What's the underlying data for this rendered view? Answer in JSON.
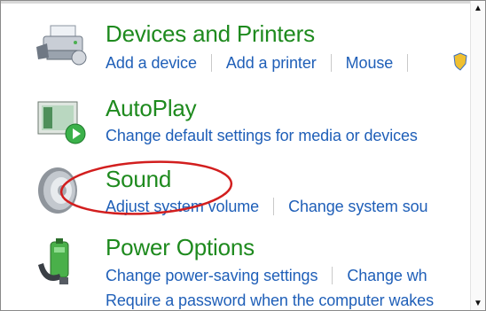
{
  "devices": {
    "title": "Devices and Printers",
    "links": [
      "Add a device",
      "Add a printer",
      "Mouse"
    ],
    "icon": "devices-printer-icon"
  },
  "autoplay": {
    "title": "AutoPlay",
    "links": [
      "Change default settings for media or devices"
    ],
    "icon": "autoplay-icon"
  },
  "sound": {
    "title": "Sound",
    "links": [
      "Adjust system volume",
      "Change system sou"
    ],
    "icon": "speaker-icon"
  },
  "power": {
    "title": "Power Options",
    "links": [
      "Change power-saving settings",
      "Change wh"
    ],
    "links_line2": "Require a password when the computer wakes",
    "icon": "battery-plug-icon"
  },
  "colors": {
    "title_green": "#1e8a1e",
    "link_blue": "#1f5fb8",
    "highlight_red": "#d21e1e"
  }
}
